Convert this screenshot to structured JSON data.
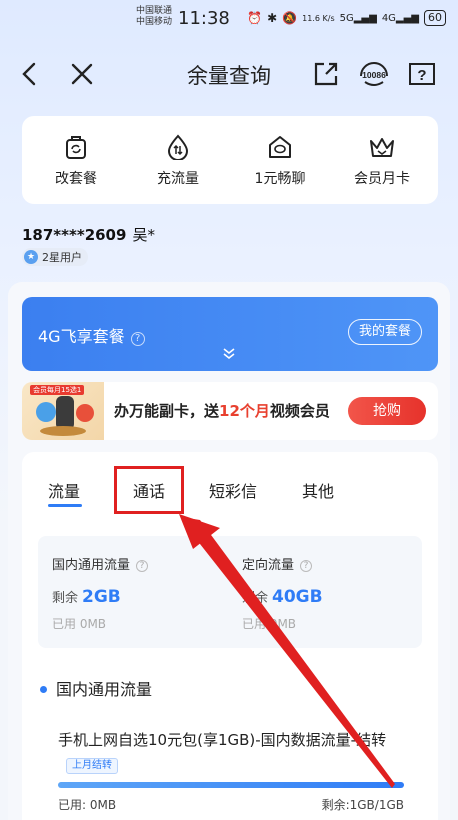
{
  "status_bar": {
    "carrier_1": "中国联通",
    "carrier_2": "中国移动",
    "time": "11:38",
    "net_speed": "11.6 K/s",
    "battery": "60"
  },
  "header": {
    "title": "余量查询",
    "service_number": "10086"
  },
  "quick_actions": [
    {
      "label": "改套餐",
      "icon": "package-change-icon"
    },
    {
      "label": "充流量",
      "icon": "data-topup-icon"
    },
    {
      "label": "1元畅聊",
      "icon": "chat-home-icon"
    },
    {
      "label": "会员月卡",
      "icon": "crown-icon"
    }
  ],
  "user": {
    "phone": "187****2609",
    "name": "吴*",
    "level": "2星用户"
  },
  "plan": {
    "name": "4G飞享套餐",
    "my_plan_label": "我的套餐"
  },
  "promo": {
    "image_tag": "会员每月15选1",
    "text_prefix": "办万能副卡，送",
    "text_highlight": "12个月",
    "text_suffix": "视频会员",
    "button": "抢购"
  },
  "tabs": [
    "流量",
    "通话",
    "短彩信",
    "其他"
  ],
  "summary": {
    "general": {
      "title": "国内通用流量",
      "remain_label": "剩余",
      "remain_value": "2GB",
      "used": "已用 0MB"
    },
    "directed": {
      "title": "定向流量",
      "remain_label": "剩余",
      "remain_value": "40GB",
      "used": "已用 0MB"
    }
  },
  "section": {
    "title": "国内通用流量",
    "package_name": "手机上网自选10元包(享1GB)-国内数据流量-结转",
    "badge": "上月结转",
    "progress_remaining_fraction": 1.0,
    "used_text": "已用: 0MB",
    "remain_text": "剩余:1GB/1GB"
  },
  "colors": {
    "accent": "#2f7cf6",
    "promo_red": "#e8402f",
    "highlight_red": "#e02020"
  }
}
